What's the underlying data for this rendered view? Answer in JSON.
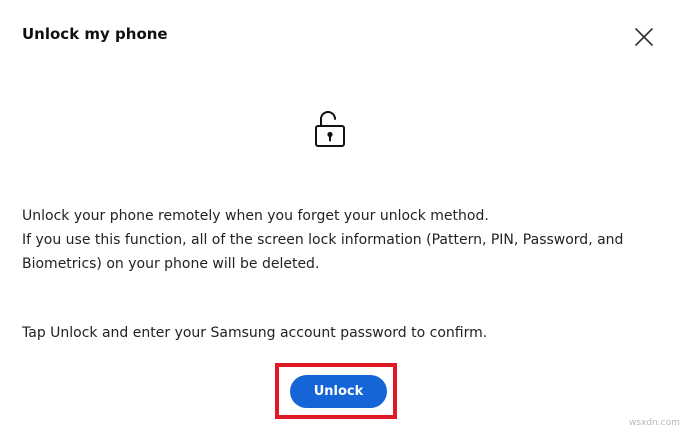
{
  "dialog": {
    "title": "Unlock my phone",
    "close_icon": "close-icon",
    "lock_icon": "unlocked-padlock-icon",
    "description_lines": [
      "Unlock your phone remotely when you forget your unlock method.",
      "If you use this function, all of the screen lock information (Pattern, PIN, Password, and Biometrics) on your phone will be deleted."
    ],
    "confirm_text": "Tap Unlock and enter your Samsung account password to confirm.",
    "unlock_button_label": "Unlock"
  },
  "watermark": "wsxdn.com",
  "colors": {
    "button": "#1565d8",
    "highlight": "#e01a22",
    "text": "#111111"
  }
}
